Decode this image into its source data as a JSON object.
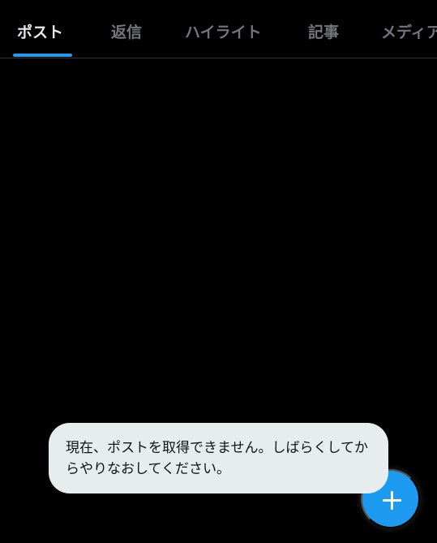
{
  "tabs": [
    {
      "label": "ポスト",
      "active": true
    },
    {
      "label": "返信",
      "active": false
    },
    {
      "label": "ハイライト",
      "active": false
    },
    {
      "label": "記事",
      "active": false
    },
    {
      "label": "メディア",
      "active": false
    }
  ],
  "toast": {
    "message": "現在、ポストを取得できません。しばらくしてからやりなおしてください。"
  },
  "fab": {
    "icon": "plus-icon"
  },
  "colors": {
    "background": "#000000",
    "accent": "#1d9bf0",
    "active_tab_text": "#e7e9ea",
    "inactive_tab_text": "#71767b",
    "toast_background": "#e7ecec",
    "toast_text": "#0f1419"
  }
}
